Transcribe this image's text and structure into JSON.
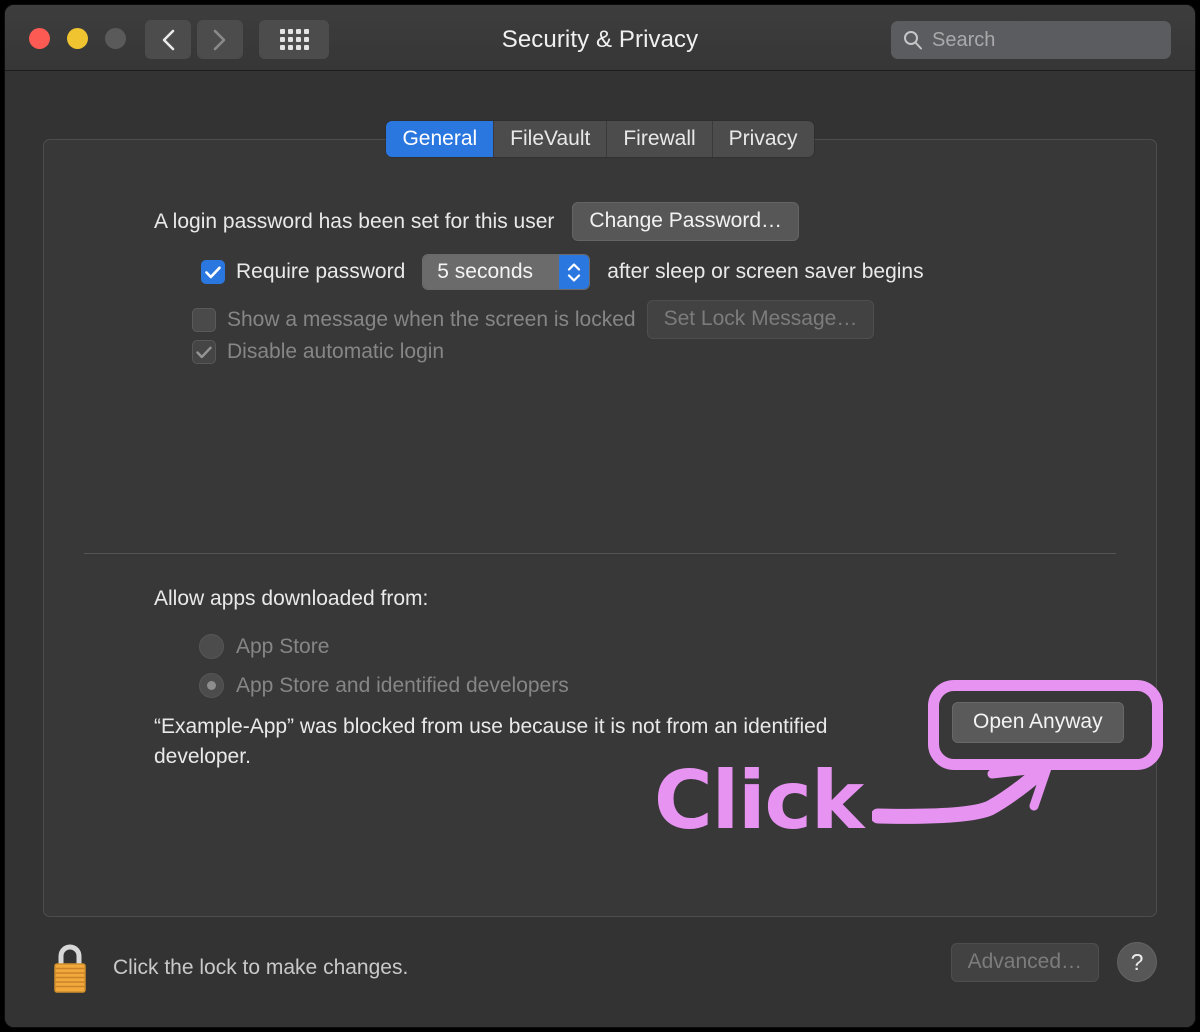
{
  "window": {
    "title": "Security & Privacy",
    "traffic_lights": {
      "close_color": "#fc5a53",
      "minimize_color": "#f0c330",
      "zoom_color": "#5a5a5a"
    },
    "nav": {
      "back_icon": "chevron-left-icon",
      "forward_icon": "chevron-right-icon",
      "grid_icon": "show-all-grid-icon"
    },
    "search": {
      "placeholder": "Search",
      "icon": "search-icon"
    }
  },
  "tabs": [
    {
      "label": "General",
      "active": true
    },
    {
      "label": "FileVault",
      "active": false
    },
    {
      "label": "Firewall",
      "active": false
    },
    {
      "label": "Privacy",
      "active": false
    }
  ],
  "general": {
    "password_status": "A login password has been set for this user",
    "change_password_button": "Change Password…",
    "require_password": {
      "label": "Require password",
      "checked": true,
      "delay_value": "5 seconds",
      "suffix": "after sleep or screen saver begins"
    },
    "show_message": {
      "label": "Show a message when the screen is locked",
      "checked": false,
      "disabled": true,
      "button": "Set Lock Message…"
    },
    "disable_auto_login": {
      "label": "Disable automatic login",
      "checked": true,
      "disabled": true
    }
  },
  "allow_apps": {
    "title": "Allow apps downloaded from:",
    "options": [
      {
        "label": "App Store",
        "selected": false
      },
      {
        "label": "App Store and identified developers",
        "selected": true
      }
    ],
    "blocked_message": "“Example-App” was blocked from use because it is not from an identified developer.",
    "open_anyway_button": "Open Anyway"
  },
  "annotation": {
    "text": "Click",
    "color": "#e793f2",
    "arrow": "curved-arrow-up-right",
    "highlight_target": "Open Anyway"
  },
  "bottom_bar": {
    "lock_icon": "lock-closed-icon",
    "lock_text": "Click the lock to make changes.",
    "advanced_button": "Advanced…",
    "help_button": "?"
  }
}
